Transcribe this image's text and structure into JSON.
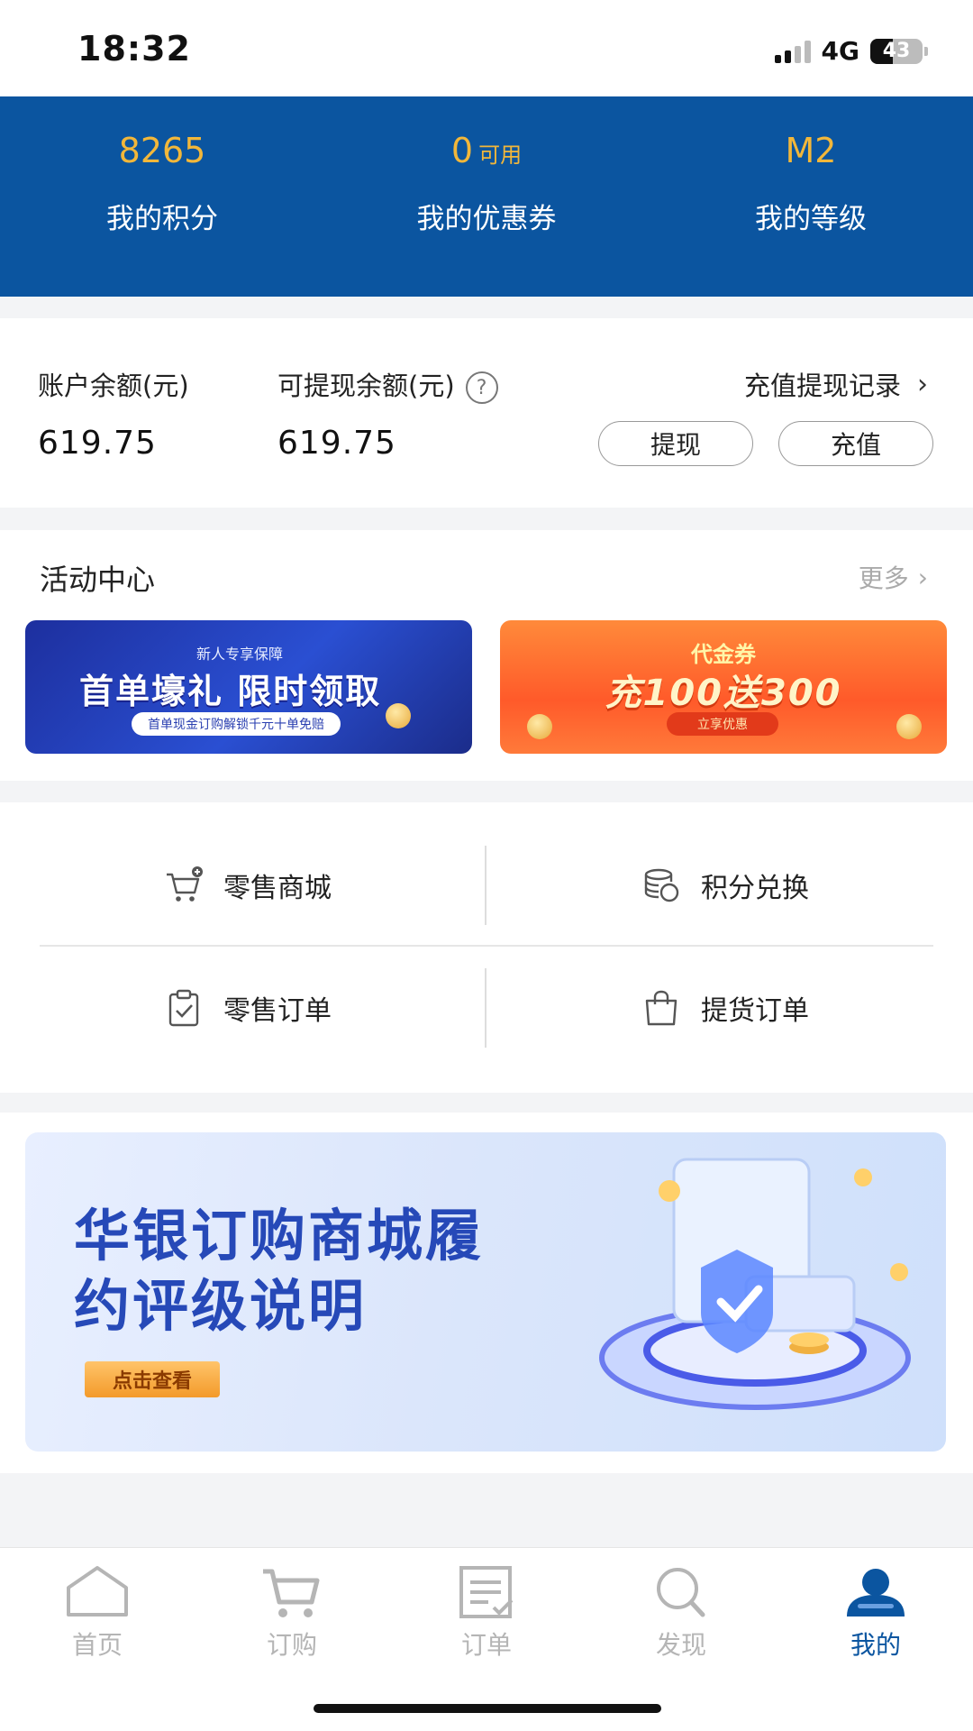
{
  "status_bar": {
    "time": "18:32",
    "network": "4G",
    "battery": "43",
    "battery_fraction": 0.43
  },
  "stats": [
    {
      "value": "8265",
      "suffix": "",
      "label": "我的积分"
    },
    {
      "value": "0",
      "suffix": "可用",
      "label": "我的优惠券"
    },
    {
      "value": "M2",
      "suffix": "",
      "label": "我的等级"
    }
  ],
  "balance": {
    "account_label": "账户余额(元)",
    "account_value": "619.75",
    "withdrawable_label": "可提现余额(元)",
    "withdrawable_value": "619.75",
    "records_link": "充值提现记录",
    "withdraw_button": "提现",
    "recharge_button": "充值"
  },
  "activity": {
    "title": "活动中心",
    "more": "更多",
    "banner1": {
      "sub": "新人专享保障",
      "main": "首单壕礼 限时领取",
      "pill": "首单现金订购解锁千元十单免赔"
    },
    "banner2": {
      "sub": "代金券",
      "main": "充100送300",
      "button": "立享优惠"
    }
  },
  "menu": {
    "retail_mall": "零售商城",
    "points_exchange": "积分兑换",
    "retail_orders": "零售订单",
    "pickup_orders": "提货订单"
  },
  "promo": {
    "line1": "华银订购商城履",
    "line2": "约评级说明",
    "button": "点击查看"
  },
  "tabs": [
    {
      "label": "首页",
      "icon": "home-icon",
      "active": false
    },
    {
      "label": "订购",
      "icon": "cart-icon",
      "active": false
    },
    {
      "label": "订单",
      "icon": "order-list-icon",
      "active": false
    },
    {
      "label": "发现",
      "icon": "search-icon",
      "active": false
    },
    {
      "label": "我的",
      "icon": "user-icon",
      "active": true
    }
  ],
  "colors": {
    "brand_blue": "#0b55a0",
    "stat_gold": "#f2b73a",
    "inactive_tab": "#b5b5b5"
  }
}
